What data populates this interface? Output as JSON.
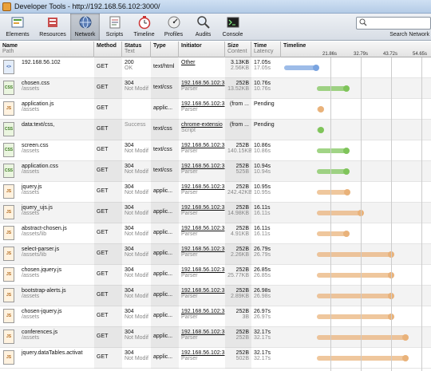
{
  "window": {
    "title": "Developer Tools - http://192.168.56.102:3000/"
  },
  "toolbar": {
    "tools": [
      {
        "label": "Elements",
        "icon": "elements-icon"
      },
      {
        "label": "Resources",
        "icon": "resources-icon"
      },
      {
        "label": "Network",
        "icon": "network-icon"
      },
      {
        "label": "Scripts",
        "icon": "scripts-icon"
      },
      {
        "label": "Timeline",
        "icon": "timeline-icon"
      },
      {
        "label": "Profiles",
        "icon": "profiles-icon"
      },
      {
        "label": "Audits",
        "icon": "audits-icon"
      },
      {
        "label": "Console",
        "icon": "console-icon"
      }
    ],
    "active": "Network",
    "search_label": "Search Network"
  },
  "columns": {
    "name": {
      "title": "Name",
      "sub": "Path"
    },
    "method": {
      "title": "Method"
    },
    "status": {
      "title": "Status",
      "sub": "Text"
    },
    "type": {
      "title": "Type"
    },
    "initiator": {
      "title": "Initiator"
    },
    "size": {
      "title": "Size",
      "sub": "Content"
    },
    "time": {
      "title": "Time",
      "sub": "Latency"
    },
    "timeline": {
      "title": "Timeline"
    }
  },
  "timeline_ticks": [
    "21.86s",
    "32.79s",
    "43.72s",
    "54.65s"
  ],
  "colors": {
    "css": "#7fc45a",
    "script": "#e9b27a",
    "document": "#7aa4e0"
  },
  "rows": [
    {
      "name": "192.168.56.102",
      "path": "",
      "method": "GET",
      "status": "200",
      "status_text": "OK",
      "type": "text/html",
      "initiator": "Other",
      "initiator_sub": "",
      "size": "3.13KB",
      "content": "2.56KB",
      "time": "17.05s",
      "latency": "17.05s",
      "kind": "document",
      "start": 0.0,
      "latency_s": 17.05,
      "end": 17.05
    },
    {
      "name": "chosen.css",
      "path": "/assets",
      "method": "GET",
      "status": "304",
      "status_text": "Not Modif",
      "type": "text/css",
      "initiator": "192.168.56.102:3",
      "initiator_sub": "Parser",
      "size": "252B",
      "content": "13.52KB",
      "time": "10.76s",
      "latency": "10.76s",
      "kind": "css",
      "start": 17.1,
      "latency_s": 10.76,
      "end": 27.86
    },
    {
      "name": "application.js",
      "path": "/assets",
      "method": "GET",
      "status": "",
      "status_text": "",
      "type": "applic...",
      "initiator": "192.168.56.102:3",
      "initiator_sub": "Parser",
      "size": "(from ...",
      "content": "",
      "time": "Pending",
      "latency": "",
      "kind": "script",
      "start": 17.1,
      "latency_s": 0,
      "end": 17.6
    },
    {
      "name": "data:text/css,",
      "path": "",
      "method": "GET",
      "status": "",
      "status_text": "Success",
      "type": "text/css",
      "initiator": "chrome-extensio",
      "initiator_sub": "Script",
      "size": "(from ...",
      "content": "",
      "time": "Pending",
      "latency": "",
      "kind": "css",
      "start": 17.1,
      "latency_s": 0,
      "end": 17.6
    },
    {
      "name": "screen.css",
      "path": "/assets",
      "method": "GET",
      "status": "304",
      "status_text": "Not Modif",
      "type": "text/css",
      "initiator": "192.168.56.102:3",
      "initiator_sub": "Parser",
      "size": "252B",
      "content": "140.15KB",
      "time": "10.86s",
      "latency": "10.86s",
      "kind": "css",
      "start": 17.1,
      "latency_s": 10.86,
      "end": 27.96
    },
    {
      "name": "application.css",
      "path": "/assets",
      "method": "GET",
      "status": "304",
      "status_text": "Not Modif",
      "type": "text/css",
      "initiator": "192.168.56.102:3",
      "initiator_sub": "Parser",
      "size": "252B",
      "content": "525B",
      "time": "10.94s",
      "latency": "10.94s",
      "kind": "css",
      "start": 17.1,
      "latency_s": 10.94,
      "end": 28.04
    },
    {
      "name": "jquery.js",
      "path": "/assets",
      "method": "GET",
      "status": "304",
      "status_text": "Not Modif",
      "type": "applic...",
      "initiator": "192.168.56.102:3",
      "initiator_sub": "Parser",
      "size": "252B",
      "content": "242.42KB",
      "time": "10.95s",
      "latency": "10.95s",
      "kind": "script",
      "start": 17.1,
      "latency_s": 10.95,
      "end": 28.05
    },
    {
      "name": "jquery_ujs.js",
      "path": "/assets",
      "method": "GET",
      "status": "304",
      "status_text": "Not Modif",
      "type": "applic...",
      "initiator": "192.168.56.102:3",
      "initiator_sub": "Parser",
      "size": "252B",
      "content": "14.98KB",
      "time": "16.11s",
      "latency": "16.11s",
      "kind": "script",
      "start": 17.1,
      "latency_s": 16.11,
      "end": 33.21
    },
    {
      "name": "abstract-chosen.js",
      "path": "/assets/lib",
      "method": "GET",
      "status": "304",
      "status_text": "Not Modif",
      "type": "applic...",
      "initiator": "192.168.56.102:3",
      "initiator_sub": "Parser",
      "size": "252B",
      "content": "4.91KB",
      "time": "16.11s",
      "latency": "16.11s",
      "kind": "script",
      "start": 17.1,
      "latency_s": 10.9,
      "end": 28.0
    },
    {
      "name": "select-parser.js",
      "path": "/assets/lib",
      "method": "GET",
      "status": "304",
      "status_text": "Not Modif",
      "type": "applic...",
      "initiator": "192.168.56.102:3",
      "initiator_sub": "Parser",
      "size": "252B",
      "content": "2.26KB",
      "time": "26.79s",
      "latency": "26.79s",
      "kind": "script",
      "start": 17.1,
      "latency_s": 26.79,
      "end": 43.89
    },
    {
      "name": "chosen.jquery.js",
      "path": "/assets",
      "method": "GET",
      "status": "304",
      "status_text": "Not Modif",
      "type": "applic...",
      "initiator": "192.168.56.102:3",
      "initiator_sub": "Parser",
      "size": "252B",
      "content": "25.77KB",
      "time": "26.85s",
      "latency": "26.85s",
      "kind": "script",
      "start": 17.1,
      "latency_s": 26.85,
      "end": 43.95
    },
    {
      "name": "bootstrap-alerts.js",
      "path": "/assets",
      "method": "GET",
      "status": "304",
      "status_text": "Not Modif",
      "type": "applic...",
      "initiator": "192.168.56.102:3",
      "initiator_sub": "Parser",
      "size": "252B",
      "content": "2.89KB",
      "time": "26.98s",
      "latency": "26.98s",
      "kind": "script",
      "start": 17.1,
      "latency_s": 26.98,
      "end": 44.08
    },
    {
      "name": "chosen-jquery.js",
      "path": "/assets",
      "method": "GET",
      "status": "304",
      "status_text": "Not Modif",
      "type": "applic...",
      "initiator": "192.168.56.102:3",
      "initiator_sub": "Parser",
      "size": "252B",
      "content": "3B",
      "time": "26.97s",
      "latency": "26.97s",
      "kind": "script",
      "start": 17.1,
      "latency_s": 26.97,
      "end": 44.07
    },
    {
      "name": "conferences.js",
      "path": "/assets",
      "method": "GET",
      "status": "304",
      "status_text": "Not Modif",
      "type": "applic...",
      "initiator": "192.168.56.102:3",
      "initiator_sub": "Parser",
      "size": "252B",
      "content": "252B",
      "time": "32.17s",
      "latency": "32.17s",
      "kind": "script",
      "start": 17.1,
      "latency_s": 32.17,
      "end": 49.27
    },
    {
      "name": "jquery.dataTables.activat",
      "path": "",
      "method": "GET",
      "status": "304",
      "status_text": "Not Modif",
      "type": "applic...",
      "initiator": "192.168.56.102:3",
      "initiator_sub": "Parser",
      "size": "252B",
      "content": "502B",
      "time": "32.17s",
      "latency": "32.17s",
      "kind": "script",
      "start": 17.1,
      "latency_s": 32.17,
      "end": 49.27
    }
  ]
}
